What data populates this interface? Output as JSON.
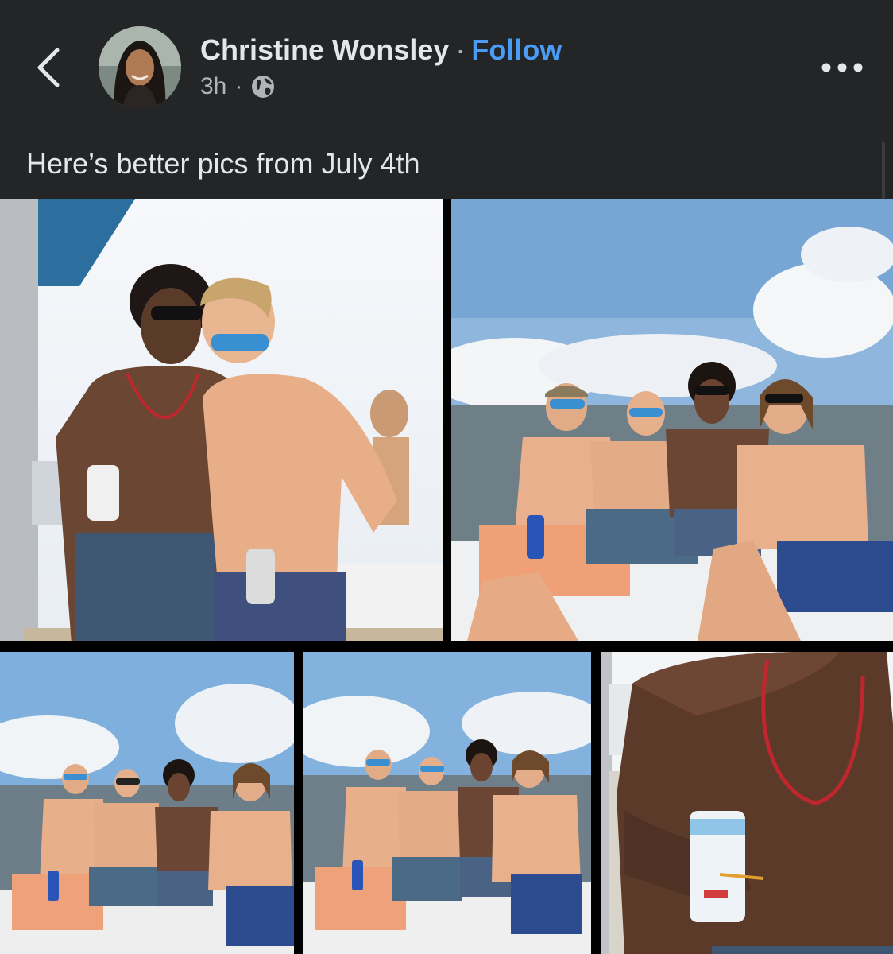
{
  "post": {
    "author": "Christine Wonsley",
    "separator": "·",
    "follow_label": "Follow",
    "time": "3h",
    "meta_separator": "·",
    "caption": "Here’s better pics from July 4th"
  },
  "icons": {
    "back": "chevron-left-icon",
    "privacy": "globe-icon",
    "more": "more-horizontal-icon"
  },
  "colors": {
    "background": "#242526",
    "follow": "#4b9cf5",
    "secondary_text": "#b0b3b8"
  },
  "photos": [
    {
      "id": "photo-1"
    },
    {
      "id": "photo-2"
    },
    {
      "id": "photo-3"
    },
    {
      "id": "photo-4"
    },
    {
      "id": "photo-5"
    }
  ]
}
